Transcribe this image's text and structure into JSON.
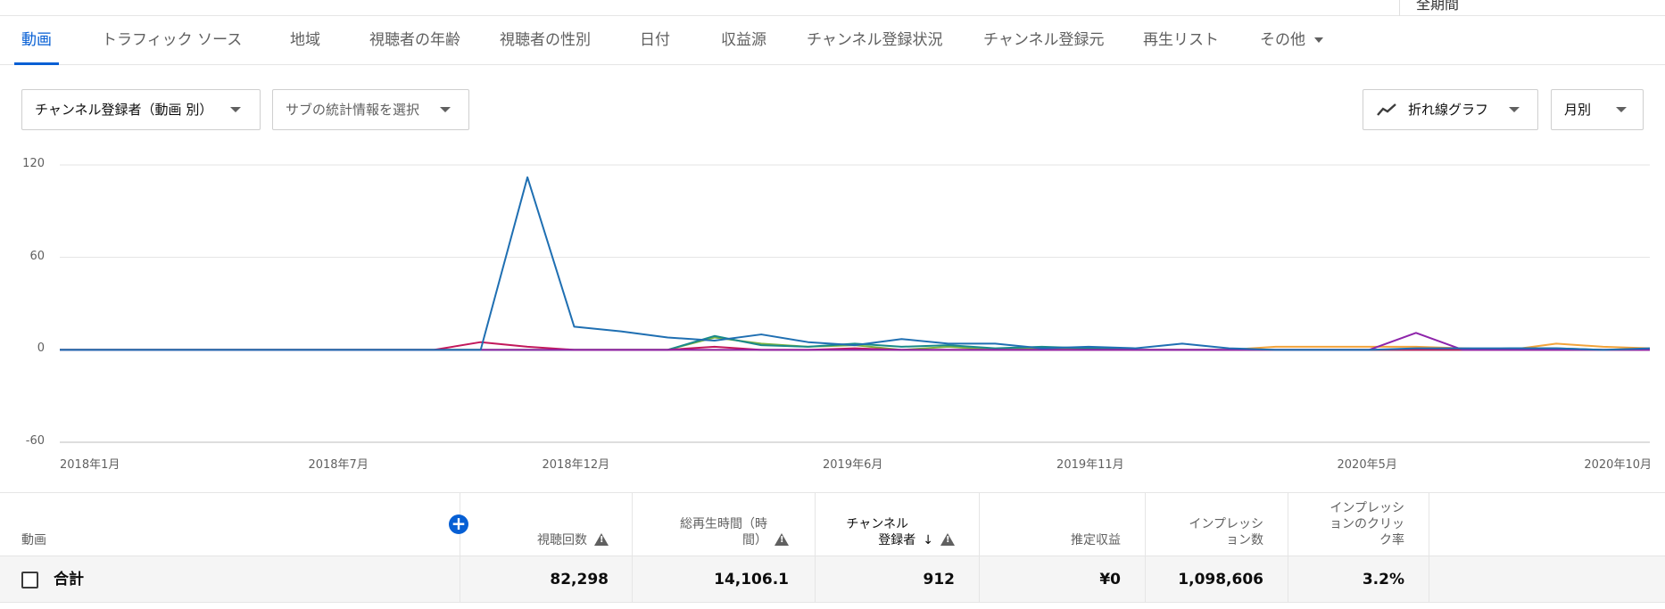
{
  "header": {
    "crumb": "全期間"
  },
  "tabs": [
    {
      "label": "動画",
      "active": true
    },
    {
      "label": "トラフィック ソース"
    },
    {
      "label": "地域"
    },
    {
      "label": "視聴者の年齢"
    },
    {
      "label": "視聴者の性別"
    },
    {
      "label": "日付"
    },
    {
      "label": "収益源"
    },
    {
      "label": "チャンネル登録状況"
    },
    {
      "label": "チャンネル登録元"
    },
    {
      "label": "再生リスト"
    },
    {
      "label": "その他"
    }
  ],
  "controls": {
    "metric_select": "チャンネル登録者（動画 別）",
    "sub_metric_select": "サブの統計情報を選択",
    "chart_type_select": "折れ線グラフ",
    "interval_select": "月別"
  },
  "chart_data": {
    "type": "line",
    "x": [
      "2018年1月",
      "2018年2月",
      "2018年3月",
      "2018年4月",
      "2018年5月",
      "2018年6月",
      "2018年7月",
      "2018年8月",
      "2018年9月",
      "2018年10月",
      "2018年11月",
      "2018年12月",
      "2019年1月",
      "2019年2月",
      "2019年3月",
      "2019年4月",
      "2019年5月",
      "2019年6月",
      "2019年7月",
      "2019年8月",
      "2019年9月",
      "2019年10月",
      "2019年11月",
      "2019年12月",
      "2020年1月",
      "2020年2月",
      "2020年3月",
      "2020年4月",
      "2020年5月",
      "2020年6月",
      "2020年7月",
      "2020年8月",
      "2020年9月",
      "2020年10月",
      "2020年11月"
    ],
    "xtick_labels": [
      "2018年1月",
      "2018年7月",
      "2018年12月",
      "2019年6月",
      "2019年11月",
      "2020年5月",
      "2020年10月"
    ],
    "ylim": [
      -60,
      120
    ],
    "yticks": [
      120,
      60,
      0,
      -60
    ],
    "grid": true,
    "series": [
      {
        "color": "#f2a33a",
        "values": [
          0,
          0,
          0,
          0,
          0,
          0,
          0,
          0,
          0,
          0,
          0,
          0,
          0,
          0,
          0,
          0,
          0,
          0,
          0,
          0,
          0,
          0,
          0,
          0,
          0,
          0,
          2,
          2,
          2,
          2,
          1,
          0,
          4,
          2,
          1
        ]
      },
      {
        "color": "#7cb342",
        "values": [
          0,
          0,
          0,
          0,
          0,
          0,
          0,
          0,
          0,
          0,
          0,
          0,
          0,
          0,
          8,
          4,
          2,
          3,
          0,
          2,
          0,
          1,
          1,
          0,
          0,
          0,
          0,
          0,
          0,
          0,
          0,
          0,
          0,
          0,
          0
        ]
      },
      {
        "color": "#1a8a8a",
        "values": [
          0,
          0,
          0,
          0,
          0,
          0,
          0,
          0,
          0,
          0,
          0,
          0,
          0,
          0,
          9,
          3,
          2,
          4,
          2,
          3,
          1,
          2,
          1,
          0,
          0,
          0,
          0,
          0,
          0,
          0,
          0,
          1,
          1,
          0,
          0
        ]
      },
      {
        "color": "#c2185b",
        "values": [
          0,
          0,
          0,
          0,
          0,
          0,
          0,
          0,
          0,
          5,
          2,
          0,
          0,
          0,
          2,
          0,
          0,
          1,
          0,
          0,
          0,
          0,
          0,
          0,
          0,
          0,
          0,
          0,
          0,
          0,
          0,
          0,
          0,
          0,
          0
        ]
      },
      {
        "color": "#8e24aa",
        "values": [
          0,
          0,
          0,
          0,
          0,
          0,
          0,
          0,
          0,
          0,
          0,
          0,
          0,
          0,
          0,
          0,
          0,
          0,
          0,
          0,
          0,
          0,
          0,
          0,
          0,
          0,
          0,
          0,
          0,
          11,
          0,
          0,
          0,
          0,
          0
        ]
      },
      {
        "color": "#1f6fb2",
        "values": [
          0,
          0,
          0,
          0,
          0,
          0,
          0,
          0,
          0,
          0,
          112,
          15,
          12,
          8,
          6,
          10,
          5,
          3,
          7,
          4,
          4,
          1,
          2,
          1,
          4,
          1,
          0,
          0,
          0,
          1,
          1,
          1,
          1,
          0,
          1
        ]
      }
    ]
  },
  "table": {
    "headers": {
      "video": "動画",
      "views": "視聴回数",
      "watch_time_1": "総再生時間（時",
      "watch_time_2": "間）",
      "subscribers_1": "チャンネル",
      "subscribers_2": "登録者",
      "revenue": "推定収益",
      "impressions_1": "インプレッシ",
      "impressions_2": "ョン数",
      "ctr_1": "インプレッシ",
      "ctr_2": "ョンのクリッ",
      "ctr_3": "ク率"
    },
    "total": {
      "label": "合計",
      "views": "82,298",
      "watch_time": "14,106.1",
      "subscribers": "912",
      "revenue": "¥0",
      "impressions": "1,098,606",
      "ctr": "3.2%"
    }
  }
}
